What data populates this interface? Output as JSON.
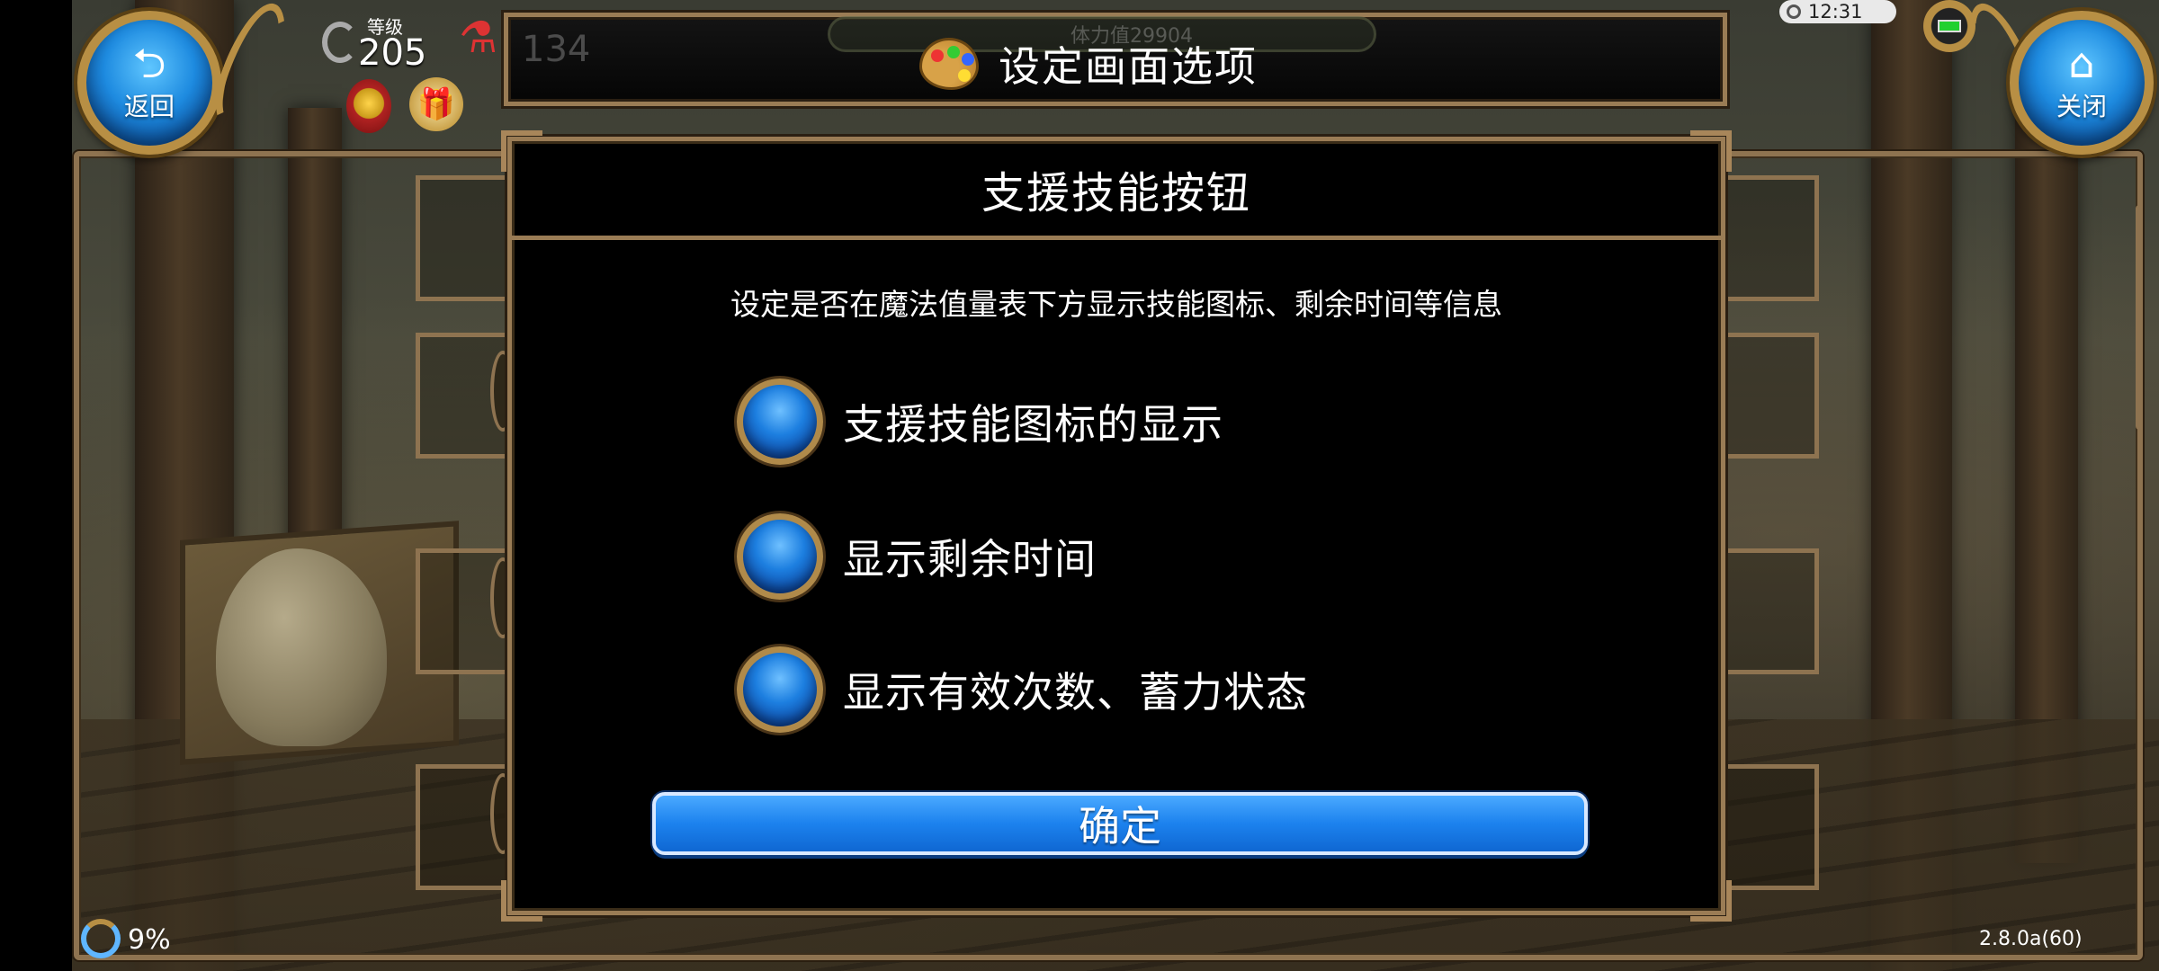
{
  "nav": {
    "back_label": "返回",
    "close_label": "关闭"
  },
  "player": {
    "level_label": "等级",
    "level_value": "205",
    "faded_number": "134"
  },
  "hp_bar": {
    "text": "体力值29904"
  },
  "status_bar": {
    "time": "12:31"
  },
  "header": {
    "title": "设定画面选项",
    "icon": "palette-icon"
  },
  "dialog": {
    "title": "支援技能按钮",
    "description": "设定是否在魔法值量表下方显示技能图标、剩余时间等信息",
    "options": [
      {
        "label": "支援技能图标的显示",
        "checked": true
      },
      {
        "label": "显示剩余时间",
        "checked": true
      },
      {
        "label": "显示有效次数、蓄力状态",
        "checked": true
      }
    ],
    "confirm_label": "确定"
  },
  "footer": {
    "network_percent": "9%",
    "version": "2.8.0a(60)"
  },
  "colors": {
    "accent_blue": "#1c82ee",
    "frame_gold": "#9a7c55",
    "dialog_bg": "#000000"
  }
}
